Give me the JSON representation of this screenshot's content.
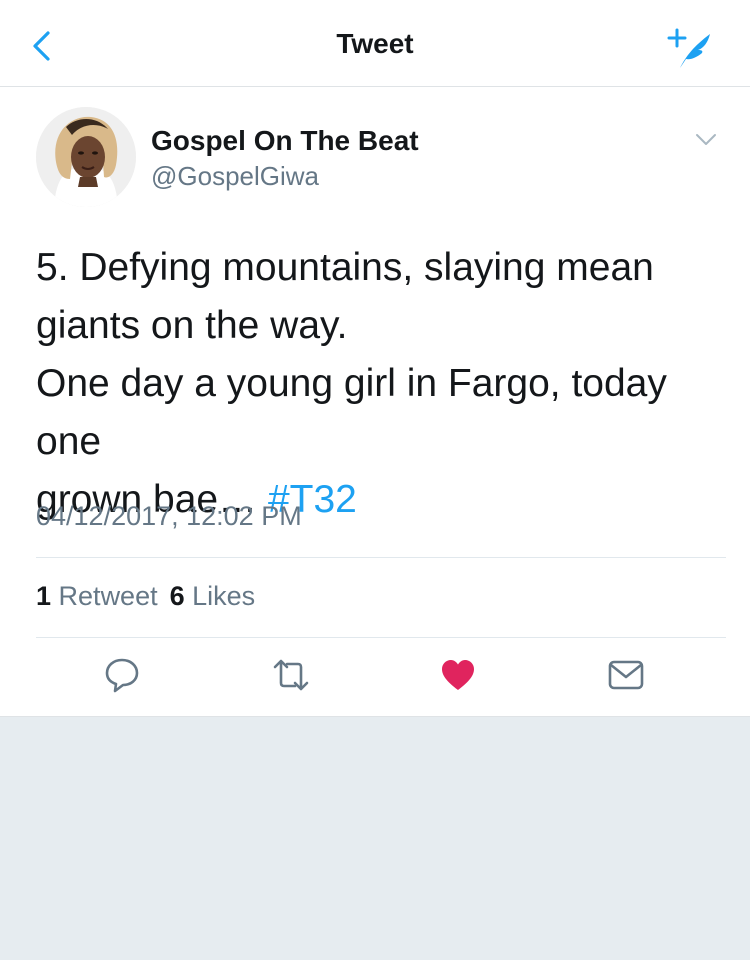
{
  "header": {
    "title": "Tweet",
    "back_icon": "chevron-left-icon",
    "compose_icon": "compose-tweet-icon",
    "accent_color": "#1da1f2"
  },
  "tweet": {
    "author": {
      "display_name": "Gospel On The Beat",
      "handle": "@GospelGiwa"
    },
    "text_lines": [
      "5. Defying mountains, slaying mean",
      "giants on the way.",
      "One day a young girl in Fargo, today one",
      "grown bae… "
    ],
    "hashtag": "#T32",
    "timestamp": "04/12/2017, 12:02 PM",
    "stats": {
      "retweets_count": "1",
      "retweets_label": "Retweet",
      "likes_count": "6",
      "likes_label": "Likes"
    },
    "actions": {
      "reply_icon": "reply-icon",
      "retweet_icon": "retweet-icon",
      "like_icon": "heart-icon",
      "liked": true,
      "like_color": "#e0245e",
      "dm_icon": "envelope-icon"
    }
  }
}
